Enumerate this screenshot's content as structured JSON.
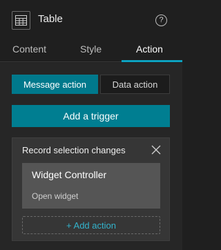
{
  "header": {
    "title": "Table",
    "help_glyph": "?",
    "icon": "table-icon"
  },
  "tabs": [
    {
      "label": "Content",
      "active": false
    },
    {
      "label": "Style",
      "active": false
    },
    {
      "label": "Action",
      "active": true
    }
  ],
  "segmented": {
    "message_action": "Message action",
    "data_action": "Data action"
  },
  "trigger_button": "Add a trigger",
  "trigger_card": {
    "title": "Record selection changes",
    "target": {
      "name": "Widget Controller",
      "action": "Open widget"
    },
    "add_action": "+ Add action"
  },
  "colors": {
    "accent": "#00798c",
    "link": "#33b3cc",
    "background": "#1f1f1f"
  }
}
